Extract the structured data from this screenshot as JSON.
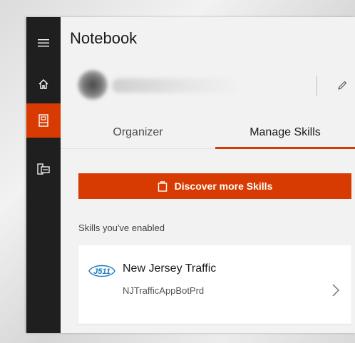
{
  "app": {
    "title": "Notebook"
  },
  "rail": {
    "items": [
      {
        "icon": "hamburger-menu-icon"
      },
      {
        "icon": "home-icon"
      },
      {
        "icon": "notebook-icon",
        "active": true
      },
      {
        "icon": "devices-icon"
      }
    ]
  },
  "profile": {
    "edit_icon": "pencil-icon"
  },
  "tabs": [
    {
      "label": "Organizer",
      "active": false
    },
    {
      "label": "Manage Skills",
      "active": true
    }
  ],
  "discover_button": {
    "label": "Discover more Skills",
    "icon": "bag-icon"
  },
  "section": {
    "label": "Skills you've enabled"
  },
  "skills": [
    {
      "name": "New Jersey Traffic",
      "id": "NJTrafficAppBotPrd",
      "logo_text": "J511"
    }
  ],
  "colors": {
    "accent": "#d83b01",
    "rail": "#1f1f1f",
    "pane": "#f2f2f2",
    "logo_blue": "#1a7bbf"
  }
}
